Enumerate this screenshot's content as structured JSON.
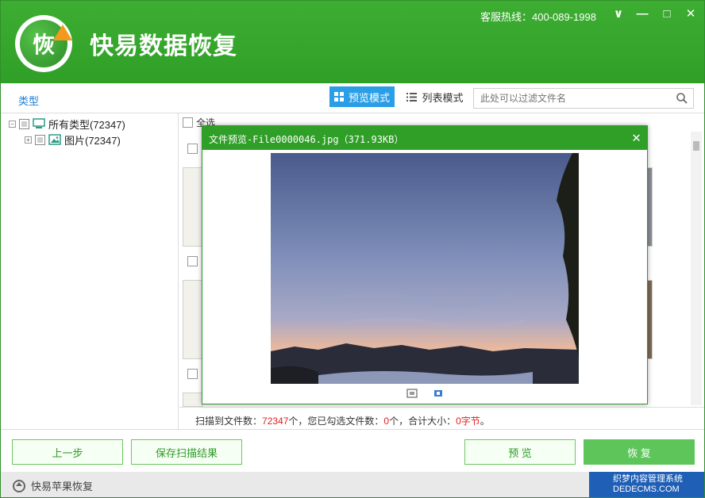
{
  "app": {
    "title": "快易数据恢复",
    "logo_char": "恢",
    "hotline": "客服热线：400-089-1998"
  },
  "window_controls": {
    "dropdown": "∨",
    "minimize": "—",
    "maximize": "□",
    "close": "✕"
  },
  "toolbar": {
    "type_label": "类型",
    "preview_mode": "预览模式",
    "list_mode": "列表模式",
    "search_placeholder": "此处可以过滤文件名"
  },
  "tree": {
    "items": [
      {
        "label": "所有类型(72347)",
        "icon": "computer-icon"
      },
      {
        "label": "图片(72347)",
        "icon": "image-icon"
      }
    ]
  },
  "panel": {
    "select_all": "全选"
  },
  "status": {
    "prefix": "扫描到文件数：",
    "scanned": "72347",
    "mid1": "个，您已勾选文件数：",
    "selected": "0",
    "mid2": "个，合计大小：",
    "size": "0字节",
    "suffix": "。"
  },
  "buttons": {
    "prev": "上一步",
    "save_scan": "保存扫描结果",
    "preview": "预 览",
    "recover": "恢 复"
  },
  "footer": {
    "link": "快易苹果恢复",
    "badge_line1": "织梦内容管理系统",
    "badge_line2": "DEDECMS.COM"
  },
  "modal": {
    "title": "文件预览-File0000046.jpg（371.93KB）",
    "close": "✕",
    "tools": [
      "fit-icon",
      "actual-size-icon"
    ]
  },
  "colors": {
    "brand_green": "#2f9f27",
    "accent_blue": "#2a9ee6",
    "status_red": "#e02020"
  }
}
